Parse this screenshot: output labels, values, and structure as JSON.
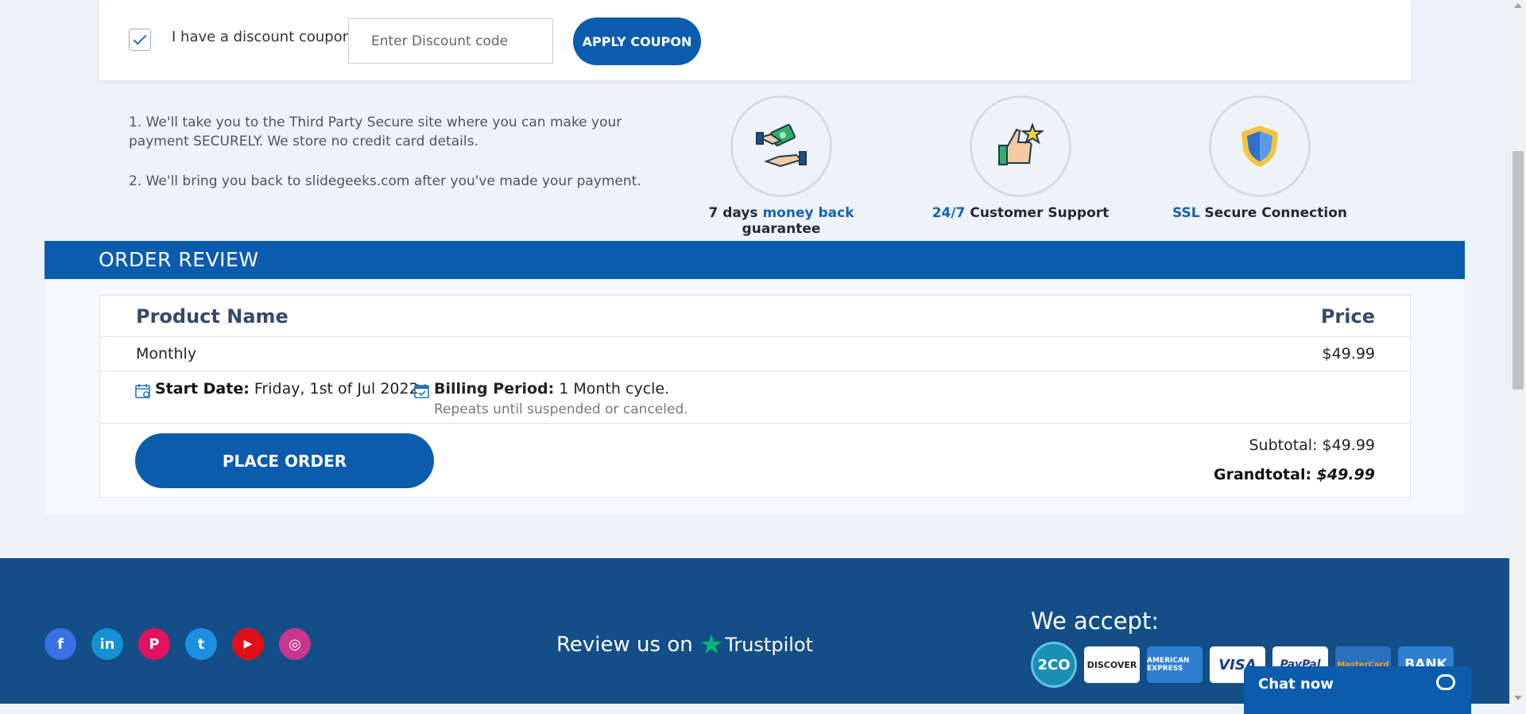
{
  "coupon": {
    "checkbox_checked": true,
    "label": "I have a discount coupon",
    "placeholder": "Enter Discount code",
    "apply_label": "APPLY COUPON"
  },
  "info": {
    "line1": "1. We'll take you to the Third Party Secure site where you can make your payment SECURELY. We store no credit card details.",
    "line2": "2. We'll bring you back to slidegeeks.com after you've made your payment."
  },
  "badges": [
    {
      "icon": "money-hand-icon",
      "pre": "7 days ",
      "highlight": "money back",
      "post": " guarantee"
    },
    {
      "icon": "thumbs-up-star-icon",
      "pre": "",
      "highlight": "24/7",
      "post": " Customer Support"
    },
    {
      "icon": "shield-icon",
      "pre": "",
      "highlight": "SSL",
      "post": " Secure Connection"
    }
  ],
  "order_review": {
    "title": "ORDER REVIEW",
    "col_product": "Product Name",
    "col_price": "Price",
    "product": "Monthly",
    "price": "$49.99",
    "start_label": "Start Date:",
    "start_value": "Friday, 1st of Jul 2022",
    "billing_label": "Billing Period:",
    "billing_value": "1 Month cycle.",
    "billing_note": "Repeats until suspended or canceled.",
    "place_order": "PLACE ORDER",
    "subtotal": "Subtotal: $49.99",
    "grandtotal_label": "Grandtotal: ",
    "grandtotal_value": "$49.99"
  },
  "footer": {
    "socials": [
      {
        "name": "facebook-icon",
        "glyph": "f",
        "color": "#3b6fe6"
      },
      {
        "name": "linkedin-icon",
        "glyph": "in",
        "color": "#1590d3"
      },
      {
        "name": "pinterest-icon",
        "glyph": "P",
        "color": "#e1125f"
      },
      {
        "name": "twitter-icon",
        "glyph": "t",
        "color": "#1d8fe0"
      },
      {
        "name": "youtube-icon",
        "glyph": "▶",
        "color": "#e0101a"
      },
      {
        "name": "instagram-icon",
        "glyph": "◎",
        "color": "#c7368f"
      }
    ],
    "review_text": "Review us on",
    "trustpilot": "Trustpilot",
    "we_accept": "We accept:",
    "payments": [
      {
        "name": "2co-logo",
        "text": "2CO"
      },
      {
        "name": "discover-logo",
        "text": "DISCOVER"
      },
      {
        "name": "amex-logo",
        "text": "AMERICAN EXPRESS"
      },
      {
        "name": "visa-logo",
        "text": "VISA"
      },
      {
        "name": "paypal-logo",
        "text": "PayPal"
      },
      {
        "name": "mastercard-logo",
        "text": "MasterCard"
      },
      {
        "name": "bank-logo",
        "text": "BANK"
      }
    ]
  },
  "chat": {
    "label": "Chat now"
  },
  "colors": {
    "primary": "#0c5cad",
    "footer": "#134e86",
    "highlight": "#1563b0"
  }
}
